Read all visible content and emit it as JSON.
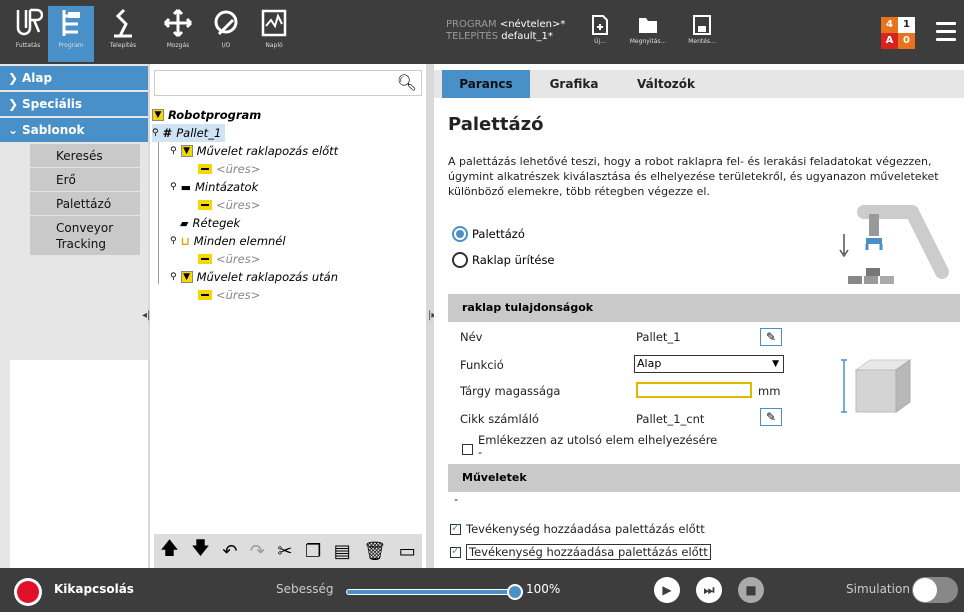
{
  "topbar": {
    "buttons": [
      {
        "label": "Futtatás",
        "icon": "ur-logo-icon"
      },
      {
        "label": "Program",
        "icon": "program-icon"
      },
      {
        "label": "Telepítés",
        "icon": "robot-arm-icon"
      },
      {
        "label": "Mozgás",
        "icon": "move-arrows-icon"
      },
      {
        "label": "I/O",
        "icon": "io-icon"
      },
      {
        "label": "Napló",
        "icon": "log-icon"
      }
    ],
    "program_key": "PROGRAM",
    "program_value": "<névtelen>*",
    "install_key": "TELEPÍTÉS",
    "install_value": "default_1*",
    "file_buttons": [
      "Új...",
      "Megnyitás...",
      "Mentés..."
    ],
    "badge": {
      "top_left": "4",
      "top_right": "1",
      "bottom_left": "A",
      "bottom_right": "0"
    },
    "colors": {
      "bar": "#3d3d3d",
      "active": "#4a90c8",
      "badge_orange": "#e8731e",
      "badge_red": "#d9231f"
    }
  },
  "leftnav": {
    "sections": [
      "Alap",
      "Speciális",
      "Sablonok"
    ],
    "sablonok_items": [
      "Keresés",
      "Erő",
      "Palettázó",
      "Conveyor Tracking"
    ]
  },
  "tree": {
    "root": "Robotprogram",
    "pallet": "Pallet_1",
    "before": "Művelet raklapozás előtt",
    "empty": "<üres>",
    "patterns": "Mintázatok",
    "layers": "Rétegek",
    "each": "Minden elemnél",
    "after": "Művelet raklapozás után"
  },
  "tabs": [
    "Parancs",
    "Grafika",
    "Változók"
  ],
  "main": {
    "title": "Palettázó",
    "description": "A palettázás lehetővé teszi, hogy a robot raklapra fel- és lerakási feladatokat végezzen, úgymint alkatrészek kiválasztása és elhelyezése területekről, és ugyanazon műveleteket különböző elemekre, több rétegben végezze el.",
    "radio_pallet": "Palettázó",
    "radio_depallet": "Raklap ürítése",
    "props_header": "raklap tulajdonságok",
    "name_label": "Név",
    "name_value": "Pallet_1",
    "function_label": "Funkció",
    "function_value": "Alap",
    "height_label": "Tárgy magassága",
    "height_unit": "mm",
    "counter_label": "Cikk számláló",
    "counter_value": "Pallet_1_cnt",
    "remember_label": "Emlékezzen az utolsó elem elhelyezésére",
    "remember_dash": "-",
    "ops_header": "Műveletek",
    "ops_value": "-",
    "check1": "Tevékenység hozzáadása palettázás előtt",
    "check2": "Tevékenység hozzáadása palettázás előtt"
  },
  "bottom": {
    "power_label": "Kikapcsolás",
    "speed_label": "Sebesség",
    "speed_value": "100%",
    "simulation_label": "Simulation"
  }
}
